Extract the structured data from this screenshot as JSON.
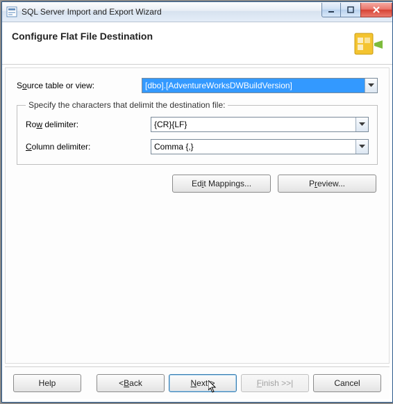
{
  "window": {
    "title": "SQL Server Import and Export Wizard"
  },
  "header": {
    "title": "Configure Flat File Destination"
  },
  "form": {
    "source_label_pre": "S",
    "source_label_key": "o",
    "source_label_post": "urce table or view:",
    "source_value": "[dbo].[AdventureWorksDWBuildVersion]"
  },
  "groupbox": {
    "legend": "Specify the characters that delimit the destination file:",
    "row_label_pre": "Ro",
    "row_label_key": "w",
    "row_label_post": " delimiter:",
    "row_value": "{CR}{LF}",
    "col_label_pre": "",
    "col_label_key": "C",
    "col_label_post": "olumn delimiter:",
    "col_value": "Comma {,}"
  },
  "buttons": {
    "edit_pre": "Ed",
    "edit_key": "i",
    "edit_post": "t Mappings...",
    "preview_pre": "P",
    "preview_key": "r",
    "preview_post": "eview..."
  },
  "footer": {
    "help": "Help",
    "back_pre": "< ",
    "back_key": "B",
    "back_post": "ack",
    "next_pre": "",
    "next_key": "N",
    "next_post": "ext >",
    "finish_pre": "",
    "finish_key": "F",
    "finish_post": "inish >>|",
    "cancel": "Cancel"
  }
}
